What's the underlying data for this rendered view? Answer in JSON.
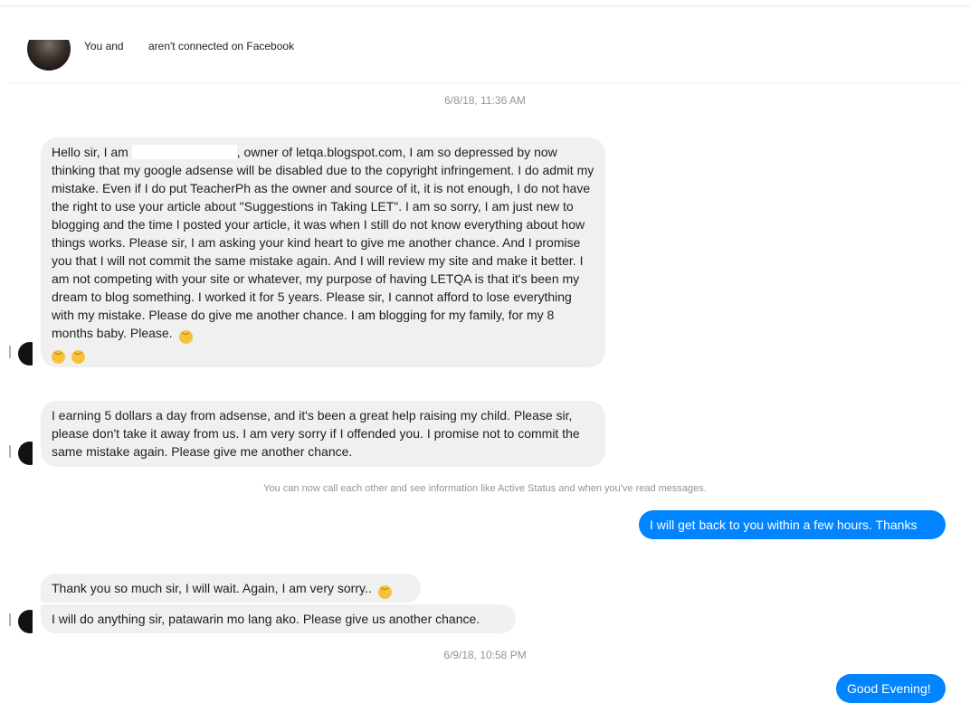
{
  "header": {
    "connect_prefix": "You and",
    "connect_suffix": "aren't connected on Facebook"
  },
  "timestamps": [
    "6/8/18, 11:36 AM",
    "6/9/18, 10:58 PM"
  ],
  "messages": {
    "m1_part1": "Hello sir, I am",
    "m1_part2": ", owner of letqa.blogspot.com, I am so depressed by now thinking that my google adsense will be disabled due to the copyright infringement. I do admit my mistake. Even if I do put TeacherPh as the owner and source of it, it is not enough, I do not have the right to use your article about \"Suggestions in Taking LET\". I am so sorry, I am just new to blogging and the time I posted your article, it was when I still do not know everything about how things works. Please sir, I am asking your kind heart to give me another chance. And I promise you that I will not commit the same mistake again. And I will review my site and make it better. I am not competing with your site or whatever, my purpose of having LETQA is that it's been my dream to blog something. I worked it for 5 years. Please sir, I cannot afford to lose everything with my mistake. Please do give me another chance. I am blogging for my family, for my 8 months baby. Please.",
    "m2": "I earning 5 dollars a day from adsense, and it's been a great help raising my child. Please sir, please don't take it away from us. I am very sorry if I offended you. I promise not to commit the same mistake again. Please give me another chance.",
    "system_note": "You can now call each other and see information like Active Status and when you've read messages.",
    "out1": "I will get back to you within a few hours. Thanks",
    "m3": "Thank you so much sir, I will wait. Again, I am very sorry..",
    "m4": "I will do anything sir, patawarin mo lang ako. Please give us another chance.",
    "out2": "Good Evening!"
  },
  "colors": {
    "incoming_bubble": "#f1f0f0",
    "outgoing_bubble": "#0084ff",
    "meta_text": "#90949c"
  },
  "icons": {
    "emoji": "pensive-face-emoji"
  }
}
